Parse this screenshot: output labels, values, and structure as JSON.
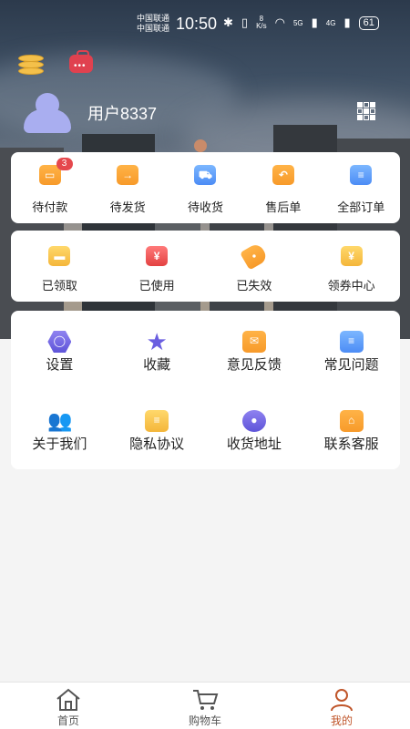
{
  "status_bar": {
    "carrier_1": "中国联通",
    "carrier_2": "中国联通",
    "time": "10:50",
    "net_speed_value": "8",
    "net_speed_unit": "K/s",
    "signal_1": "5G",
    "signal_2": "4G",
    "battery": "61"
  },
  "profile": {
    "username": "用户8337"
  },
  "orders": {
    "items": [
      {
        "label": "待付款",
        "badge": "3",
        "icon": "pending-payment-icon"
      },
      {
        "label": "待发货",
        "icon": "pending-shipment-icon"
      },
      {
        "label": "待收货",
        "icon": "pending-receipt-icon"
      },
      {
        "label": "售后单",
        "icon": "after-sales-icon"
      },
      {
        "label": "全部订单",
        "icon": "all-orders-icon"
      }
    ]
  },
  "coupons": {
    "items": [
      {
        "label": "已领取",
        "icon": "coupon-claimed-icon"
      },
      {
        "label": "已使用",
        "icon": "coupon-used-icon"
      },
      {
        "label": "已失效",
        "icon": "coupon-expired-icon"
      },
      {
        "label": "领券中心",
        "icon": "coupon-center-icon"
      }
    ]
  },
  "services": {
    "items": [
      {
        "label": "设置",
        "icon": "settings-icon"
      },
      {
        "label": "收藏",
        "icon": "favorites-icon"
      },
      {
        "label": "意见反馈",
        "icon": "feedback-icon"
      },
      {
        "label": "常见问题",
        "icon": "faq-icon"
      },
      {
        "label": "关于我们",
        "icon": "about-us-icon"
      },
      {
        "label": "隐私协议",
        "icon": "privacy-icon"
      },
      {
        "label": "收货地址",
        "icon": "address-icon"
      },
      {
        "label": "联系客服",
        "icon": "customer-service-icon"
      }
    ]
  },
  "bottom_nav": {
    "tabs": [
      {
        "label": "首页",
        "icon": "home-icon"
      },
      {
        "label": "购物车",
        "icon": "cart-icon"
      },
      {
        "label": "我的",
        "icon": "profile-icon",
        "active": true
      }
    ]
  },
  "colors": {
    "accent": "#c0562b",
    "badge": "#e5484d",
    "avatar": "#a9aef0"
  }
}
